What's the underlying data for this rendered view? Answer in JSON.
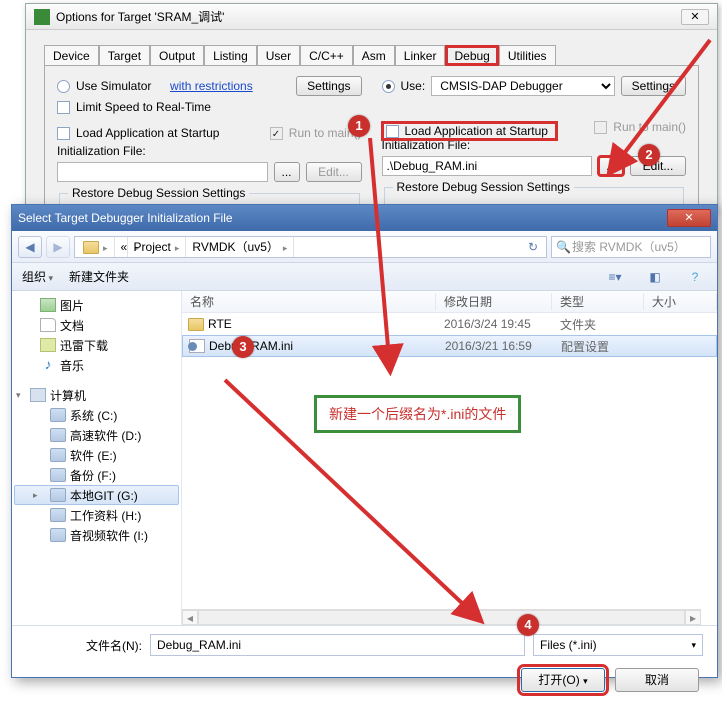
{
  "options": {
    "title": "Options for Target 'SRAM_调试'",
    "tabs": [
      "Device",
      "Target",
      "Output",
      "Listing",
      "User",
      "C/C++",
      "Asm",
      "Linker",
      "Debug",
      "Utilities"
    ],
    "left": {
      "use_sim": "Use Simulator",
      "restrictions": "with restrictions",
      "settings": "Settings",
      "limit_speed": "Limit Speed to Real-Time",
      "load_app": "Load Application at Startup",
      "run_main": "Run to main()",
      "init_file_label": "Initialization File:",
      "init_value": "",
      "edit": "Edit...",
      "restore": "Restore Debug Session Settings"
    },
    "right": {
      "use": "Use:",
      "debugger": "CMSIS-DAP Debugger",
      "settings": "Settings",
      "load_app": "Load Application at Startup",
      "run_main": "Run to main()",
      "init_file_label": "Initialization File:",
      "init_value": ".\\Debug_RAM.ini",
      "browse": "...",
      "edit": "Edit...",
      "restore": "Restore Debug Session Settings"
    }
  },
  "file_dialog": {
    "title": "Select Target Debugger Initialization File",
    "breadcrumb": [
      "Project",
      "RVMDK（uv5）"
    ],
    "search_placeholder": "搜索 RVMDK（uv5）",
    "toolbar": {
      "organize": "组织",
      "new_folder": "新建文件夹"
    },
    "side": {
      "pictures": "图片",
      "documents": "文档",
      "downloads": "迅雷下载",
      "music": "音乐",
      "computer": "计算机",
      "drives": [
        "系统 (C:)",
        "高速软件 (D:)",
        "软件 (E:)",
        "备份 (F:)",
        "本地GIT  (G:)",
        "工作资料 (H:)",
        "音视频软件 (I:)"
      ]
    },
    "columns": {
      "name": "名称",
      "date": "修改日期",
      "type": "类型",
      "size": "大小"
    },
    "files": [
      {
        "name": "RTE",
        "date": "2016/3/24 19:45",
        "type": "文件夹",
        "icon": "folder"
      },
      {
        "name": "Debug_RAM.ini",
        "date": "2016/3/21 16:59",
        "type": "配置设置",
        "icon": "ini",
        "selected": true
      }
    ],
    "footer": {
      "filename_label": "文件名(N):",
      "filename_value": "Debug_RAM.ini",
      "filter": "Files (*.ini)",
      "open": "打开(O)",
      "cancel": "取消"
    }
  },
  "annotations": {
    "badges": [
      "1",
      "2",
      "3",
      "4"
    ],
    "green_text": "新建一个后缀名为*.ini的文件"
  }
}
